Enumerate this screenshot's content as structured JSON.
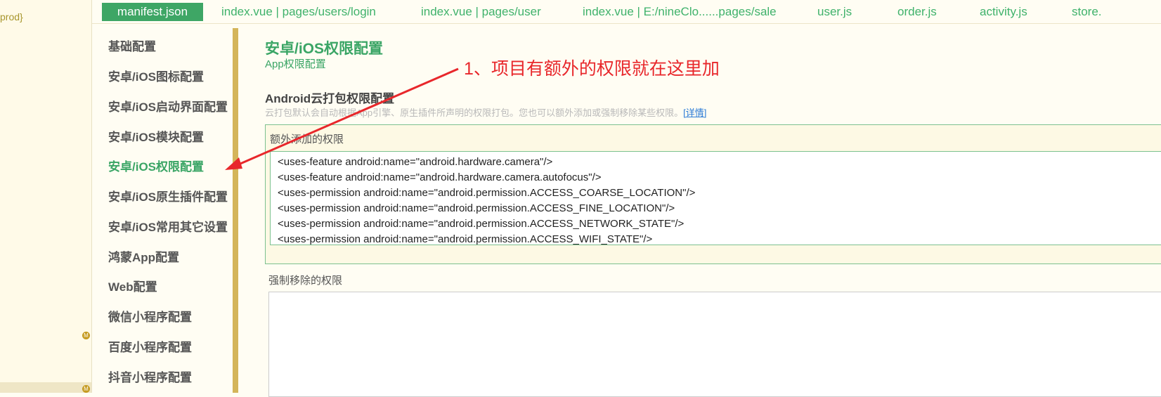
{
  "file_tree": {
    "prod_label": "prod}",
    "badge_letter": "M"
  },
  "tabs": [
    {
      "label": "manifest.json",
      "active": true
    },
    {
      "label": "index.vue | pages/users/login"
    },
    {
      "label": "index.vue | pages/user"
    },
    {
      "label": "index.vue | E:/nineClo......pages/sale"
    },
    {
      "label": "user.js"
    },
    {
      "label": "order.js"
    },
    {
      "label": "activity.js"
    },
    {
      "label": "store."
    }
  ],
  "sidebar": {
    "items": [
      {
        "label": "基础配置"
      },
      {
        "label": "安卓/iOS图标配置"
      },
      {
        "label": "安卓/iOS启动界面配置"
      },
      {
        "label": "安卓/iOS模块配置"
      },
      {
        "label": "安卓/iOS权限配置",
        "active": true
      },
      {
        "label": "安卓/iOS原生插件配置"
      },
      {
        "label": "安卓/iOS常用其它设置"
      },
      {
        "label": "鸿蒙App配置"
      },
      {
        "label": "Web配置"
      },
      {
        "label": "微信小程序配置"
      },
      {
        "label": "百度小程序配置"
      },
      {
        "label": "抖音小程序配置"
      }
    ]
  },
  "content": {
    "title": "安卓/iOS权限配置",
    "subtitle": "App权限配置",
    "annotation": "1、项目有额外的权限就在这里加",
    "section_title": "Android云打包权限配置",
    "section_desc": "云打包默认会自动根据App引擎、原生插件所声明的权限打包。您也可以额外添加或强制移除某些权限。",
    "details_link": "[详情]",
    "extra_label": "额外添加的权限",
    "extra_permissions": "<uses-feature android:name=\"android.hardware.camera\"/>\n<uses-feature android:name=\"android.hardware.camera.autofocus\"/>\n<uses-permission android:name=\"android.permission.ACCESS_COARSE_LOCATION\"/>\n<uses-permission android:name=\"android.permission.ACCESS_FINE_LOCATION\"/>\n<uses-permission android:name=\"android.permission.ACCESS_NETWORK_STATE\"/>\n<uses-permission android:name=\"android.permission.ACCESS_WIFI_STATE\"/>",
    "remove_label": "强制移除的权限",
    "remove_permissions": ""
  },
  "colors": {
    "accent": "#3aa565",
    "annotation_red": "#e8272b",
    "rail": "#d4b55a",
    "background": "#fffdf3"
  }
}
